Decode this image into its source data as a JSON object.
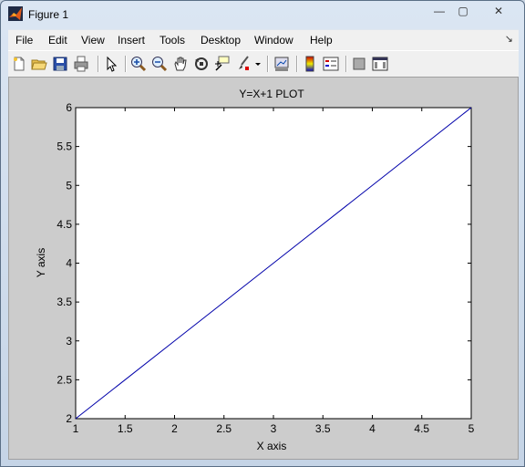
{
  "window": {
    "title": "Figure 1"
  },
  "controls": {
    "minimize": "—",
    "maximize": "▢",
    "close": "✕"
  },
  "menu": {
    "items": [
      "File",
      "Edit",
      "View",
      "Insert",
      "Tools",
      "Desktop",
      "Window",
      "Help"
    ],
    "overflow": "↘"
  },
  "toolbar": {
    "icons": [
      "new-figure-icon",
      "open-file-icon",
      "save-icon",
      "print-icon",
      "edit-plot-arrow-icon",
      "zoom-in-icon",
      "zoom-out-icon",
      "pan-hand-icon",
      "rotate-3d-icon",
      "data-cursor-icon",
      "brush-icon",
      "link-plot-icon",
      "colorbar-icon",
      "legend-icon",
      "hide-plot-tools-icon",
      "show-plot-tools-icon"
    ]
  },
  "chart_data": {
    "type": "line",
    "title": "Y=X+1 PLOT",
    "xlabel": "X axis",
    "ylabel": "Y axis",
    "xlim": [
      1,
      5
    ],
    "ylim": [
      2,
      6
    ],
    "xticks": [
      "1",
      "1.5",
      "2",
      "2.5",
      "3",
      "3.5",
      "4",
      "4.5",
      "5"
    ],
    "yticks": [
      "2",
      "2.5",
      "3",
      "3.5",
      "4",
      "4.5",
      "5",
      "5.5",
      "6"
    ],
    "grid": false,
    "series": [
      {
        "x": [
          1,
          2,
          3,
          4,
          5
        ],
        "y": [
          2,
          3,
          4,
          5,
          6
        ],
        "color": "#0000aa"
      }
    ]
  },
  "colors": {
    "figure_bg": "#cccccc",
    "axes_bg": "#ffffff",
    "line": "#0000aa"
  }
}
